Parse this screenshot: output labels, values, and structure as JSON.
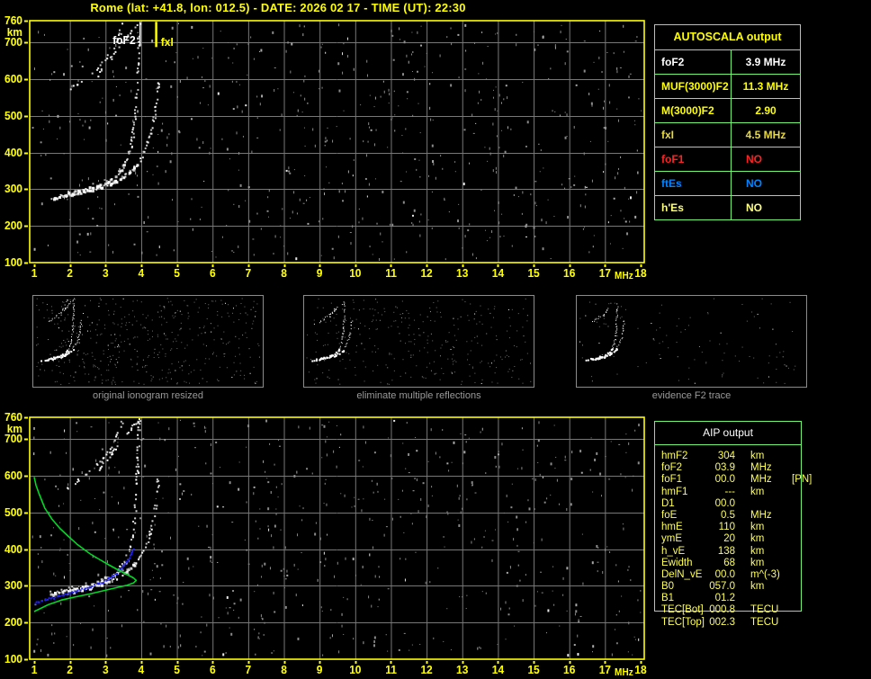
{
  "title": "Rome (lat: +41.8, lon: 012.5) - DATE: 2026 02 17 - TIME (UT): 22:30",
  "palette": {
    "title": "#ffff00",
    "axis": "#ffff00",
    "plot_border": "#ffff00",
    "grid": "#787878",
    "table_border": "#72f372",
    "noise": "#8a8a8a",
    "thumb_label": "#9a9a9a",
    "trace_white": "#ffffff",
    "restored_trace_blue": "#2222f0",
    "profile_green": "#00d825",
    "aip_text": "#ffff55",
    "aip_header": "#ffffff",
    "red": "#ff2222",
    "blue": "#0084ff"
  },
  "autoscala": {
    "header": "AUTOSCALA output",
    "rows": [
      {
        "label": "foF2",
        "value": "3.9 MHz",
        "color": "#ffffff"
      },
      {
        "label": "MUF(3000)F2",
        "value": "11.3 MHz",
        "color": "#ffff00"
      },
      {
        "label": "M(3000)F2",
        "value": "2.90",
        "color": "#ffff00"
      },
      {
        "label": "fxI",
        "value": "4.5 MHz",
        "color": "#e8d93c"
      },
      {
        "label": "foF1",
        "value": "NO",
        "color": "#ff2222"
      },
      {
        "label": "ftEs",
        "value": "NO",
        "color": "#0084ff"
      },
      {
        "label": "h'Es",
        "value": "NO",
        "color": "#ffff80"
      }
    ]
  },
  "thumbnails": [
    {
      "label": "original ionogram resized",
      "noise_count": 450,
      "hop_fraction": 1.0,
      "drop": 0.3
    },
    {
      "label": "eliminate multiple reflections",
      "noise_count": 300,
      "hop_fraction": 0.7,
      "drop": 0.32
    },
    {
      "label": "evidence F2 trace",
      "noise_count": 110,
      "hop_fraction": 0.45,
      "drop": 0.35
    }
  ],
  "aip": {
    "header": "AIP output",
    "rows": [
      {
        "label": "hmF2",
        "value": "304",
        "unit": "km",
        "extra": ""
      },
      {
        "label": "foF2",
        "value": "03.9",
        "unit": "MHz",
        "extra": ""
      },
      {
        "label": "foF1",
        "value": "00.0",
        "unit": "MHz",
        "extra": "[PN]"
      },
      {
        "label": "hmF1",
        "value": "---",
        "unit": "km",
        "extra": ""
      },
      {
        "label": "D1",
        "value": "00.0",
        "unit": "",
        "extra": ""
      },
      {
        "label": "foE",
        "value": "0.5",
        "unit": "MHz",
        "extra": ""
      },
      {
        "label": "hmE",
        "value": "110",
        "unit": "km",
        "extra": ""
      },
      {
        "label": "ymE",
        "value": "20",
        "unit": "km",
        "extra": ""
      },
      {
        "label": "h_vE",
        "value": "138",
        "unit": "km",
        "extra": ""
      },
      {
        "label": "Ewidth",
        "value": "68",
        "unit": "km",
        "extra": ""
      },
      {
        "label": "DelN_vE",
        "value": "00.0",
        "unit": "m^(-3)",
        "extra": ""
      },
      {
        "label": "B0",
        "value": "057.0",
        "unit": "km",
        "extra": ""
      },
      {
        "label": "B1",
        "value": "01.2",
        "unit": "",
        "extra": ""
      },
      {
        "label": "TEC[Bot]",
        "value": "000.8",
        "unit": "TECU",
        "extra": ""
      },
      {
        "label": "TEC[Top]",
        "value": "002.3",
        "unit": "TECU",
        "extra": ""
      }
    ]
  },
  "chart_data": [
    {
      "name": "scaled ionogram",
      "type": "scatter",
      "xlabel": "MHz",
      "ylabel": "km",
      "xlim": [
        1,
        18
      ],
      "ylim": [
        100,
        760
      ],
      "x_ticks": [
        1,
        2,
        3,
        4,
        5,
        6,
        7,
        8,
        9,
        10,
        11,
        12,
        13,
        14,
        15,
        16,
        17,
        18
      ],
      "y_ticks": [
        760,
        700,
        600,
        500,
        400,
        300,
        200,
        100
      ],
      "grid": true,
      "annotations": [
        {
          "text": "foF2",
          "color": "#ffffff",
          "x": 3.2,
          "y": 695
        },
        {
          "text": "fxI",
          "color": "#ffff00",
          "x": 4.55,
          "y": 692
        }
      ],
      "markers": [
        {
          "name": "foF2-marker",
          "x": 3.97,
          "h1": 690,
          "h2": 757,
          "color": "#ffffff",
          "w": 1.5
        },
        {
          "name": "fxI-marker",
          "x": 4.42,
          "h1": 688,
          "h2": 757,
          "color": "#ffff00",
          "w": 2.5
        }
      ],
      "series": [
        {
          "name": "F2 ordinary trace",
          "color": "#ffffff",
          "style": "dots",
          "points": [
            [
              1.45,
              278
            ],
            [
              1.7,
              284
            ],
            [
              2.0,
              291
            ],
            [
              2.3,
              298
            ],
            [
              2.6,
              306
            ],
            [
              2.9,
              316
            ],
            [
              3.15,
              329
            ],
            [
              3.35,
              345
            ],
            [
              3.5,
              365
            ],
            [
              3.6,
              388
            ],
            [
              3.68,
              412
            ],
            [
              3.73,
              438
            ],
            [
              3.77,
              465
            ],
            [
              3.8,
              495
            ],
            [
              3.84,
              545
            ],
            [
              3.87,
              610
            ],
            [
              3.89,
              670
            ],
            [
              3.91,
              725
            ],
            [
              3.92,
              758
            ]
          ]
        },
        {
          "name": "F2 extraordinary trace",
          "color": "#ffffff",
          "style": "dots",
          "points": [
            [
              1.9,
              284
            ],
            [
              2.3,
              293
            ],
            [
              2.7,
              303
            ],
            [
              3.1,
              316
            ],
            [
              3.4,
              330
            ],
            [
              3.65,
              348
            ],
            [
              3.85,
              368
            ],
            [
              4.0,
              390
            ],
            [
              4.12,
              415
            ],
            [
              4.22,
              442
            ],
            [
              4.3,
              472
            ],
            [
              4.36,
              505
            ],
            [
              4.4,
              540
            ],
            [
              4.44,
              575
            ],
            [
              4.46,
              600
            ]
          ]
        },
        {
          "name": "second reflection O",
          "color": "#ffffff",
          "style": "dots",
          "points": [
            [
              1.9,
              570
            ],
            [
              2.15,
              585
            ],
            [
              2.4,
              602
            ],
            [
              2.65,
              622
            ],
            [
              2.85,
              642
            ],
            [
              3.05,
              665
            ],
            [
              3.2,
              688
            ],
            [
              3.32,
              712
            ],
            [
              3.42,
              738
            ],
            [
              3.47,
              758
            ]
          ]
        },
        {
          "name": "second reflection X",
          "color": "#ffffff",
          "style": "dots",
          "points": [
            [
              2.75,
              612
            ],
            [
              2.95,
              638
            ],
            [
              3.15,
              662
            ],
            [
              3.35,
              688
            ],
            [
              3.55,
              715
            ],
            [
              3.78,
              742
            ],
            [
              3.95,
              758
            ]
          ]
        }
      ],
      "noise_count": 620
    },
    {
      "name": "ionogram with restored trace and electron density profile",
      "type": "scatter",
      "xlabel": "MHz",
      "ylabel": "km",
      "xlim": [
        1,
        18
      ],
      "ylim": [
        100,
        760
      ],
      "x_ticks": [
        1,
        2,
        3,
        4,
        5,
        6,
        7,
        8,
        9,
        10,
        11,
        12,
        13,
        14,
        15,
        16,
        17,
        18
      ],
      "y_ticks": [
        760,
        700,
        600,
        500,
        400,
        300,
        200,
        100
      ],
      "grid": true,
      "annotations": [],
      "markers": [],
      "series": [
        {
          "name": "F2 ordinary trace",
          "color": "#ffffff",
          "style": "dots",
          "points": [
            [
              1.45,
              278
            ],
            [
              1.7,
              284
            ],
            [
              2.0,
              291
            ],
            [
              2.3,
              298
            ],
            [
              2.6,
              306
            ],
            [
              2.9,
              316
            ],
            [
              3.15,
              329
            ],
            [
              3.35,
              345
            ],
            [
              3.5,
              365
            ],
            [
              3.6,
              388
            ],
            [
              3.68,
              412
            ],
            [
              3.73,
              438
            ],
            [
              3.77,
              465
            ],
            [
              3.8,
              495
            ],
            [
              3.84,
              545
            ],
            [
              3.87,
              610
            ],
            [
              3.89,
              670
            ],
            [
              3.91,
              725
            ],
            [
              3.92,
              758
            ]
          ]
        },
        {
          "name": "F2 extraordinary trace",
          "color": "#ffffff",
          "style": "dots",
          "points": [
            [
              1.9,
              284
            ],
            [
              2.3,
              293
            ],
            [
              2.7,
              303
            ],
            [
              3.1,
              316
            ],
            [
              3.4,
              330
            ],
            [
              3.65,
              348
            ],
            [
              3.85,
              368
            ],
            [
              4.0,
              390
            ],
            [
              4.12,
              415
            ],
            [
              4.22,
              442
            ],
            [
              4.3,
              472
            ],
            [
              4.36,
              505
            ],
            [
              4.4,
              540
            ],
            [
              4.44,
              575
            ],
            [
              4.46,
              600
            ]
          ]
        },
        {
          "name": "second reflection O",
          "color": "#ffffff",
          "style": "dots",
          "points": [
            [
              1.9,
              570
            ],
            [
              2.15,
              585
            ],
            [
              2.4,
              602
            ],
            [
              2.65,
              622
            ],
            [
              2.85,
              642
            ],
            [
              3.05,
              665
            ],
            [
              3.2,
              688
            ],
            [
              3.32,
              712
            ],
            [
              3.42,
              738
            ],
            [
              3.47,
              758
            ]
          ]
        },
        {
          "name": "second reflection X",
          "color": "#ffffff",
          "style": "dots",
          "points": [
            [
              2.75,
              612
            ],
            [
              2.95,
              638
            ],
            [
              3.15,
              662
            ],
            [
              3.35,
              688
            ],
            [
              3.55,
              715
            ],
            [
              3.78,
              742
            ],
            [
              3.95,
              758
            ]
          ]
        },
        {
          "name": "restored trace",
          "color": "#2222f0",
          "style": "dots-small",
          "points": [
            [
              1.0,
              255
            ],
            [
              1.4,
              266
            ],
            [
              1.8,
              277
            ],
            [
              2.2,
              289
            ],
            [
              2.6,
              301
            ],
            [
              2.9,
              313
            ],
            [
              3.15,
              327
            ],
            [
              3.35,
              343
            ],
            [
              3.5,
              360
            ],
            [
              3.62,
              377
            ],
            [
              3.72,
              392
            ],
            [
              3.79,
              404
            ]
          ]
        },
        {
          "name": "electron density profile",
          "color": "#00d825",
          "style": "line",
          "points": [
            [
              1.0,
              230
            ],
            [
              1.4,
              249
            ],
            [
              1.75,
              261
            ],
            [
              2.15,
              270
            ],
            [
              2.55,
              278
            ],
            [
              2.95,
              287
            ],
            [
              3.3,
              295
            ],
            [
              3.6,
              302
            ],
            [
              3.78,
              308
            ],
            [
              3.86,
              315
            ],
            [
              3.78,
              322
            ],
            [
              3.62,
              330
            ],
            [
              3.4,
              341
            ],
            [
              3.1,
              357
            ],
            [
              2.8,
              374
            ],
            [
              2.56,
              388
            ],
            [
              2.2,
              414
            ],
            [
              1.95,
              436
            ],
            [
              1.73,
              456
            ],
            [
              1.5,
              482
            ],
            [
              1.3,
              512
            ],
            [
              1.15,
              548
            ],
            [
              1.05,
              575
            ],
            [
              1.0,
              597
            ]
          ]
        }
      ],
      "noise_count": 620
    }
  ]
}
